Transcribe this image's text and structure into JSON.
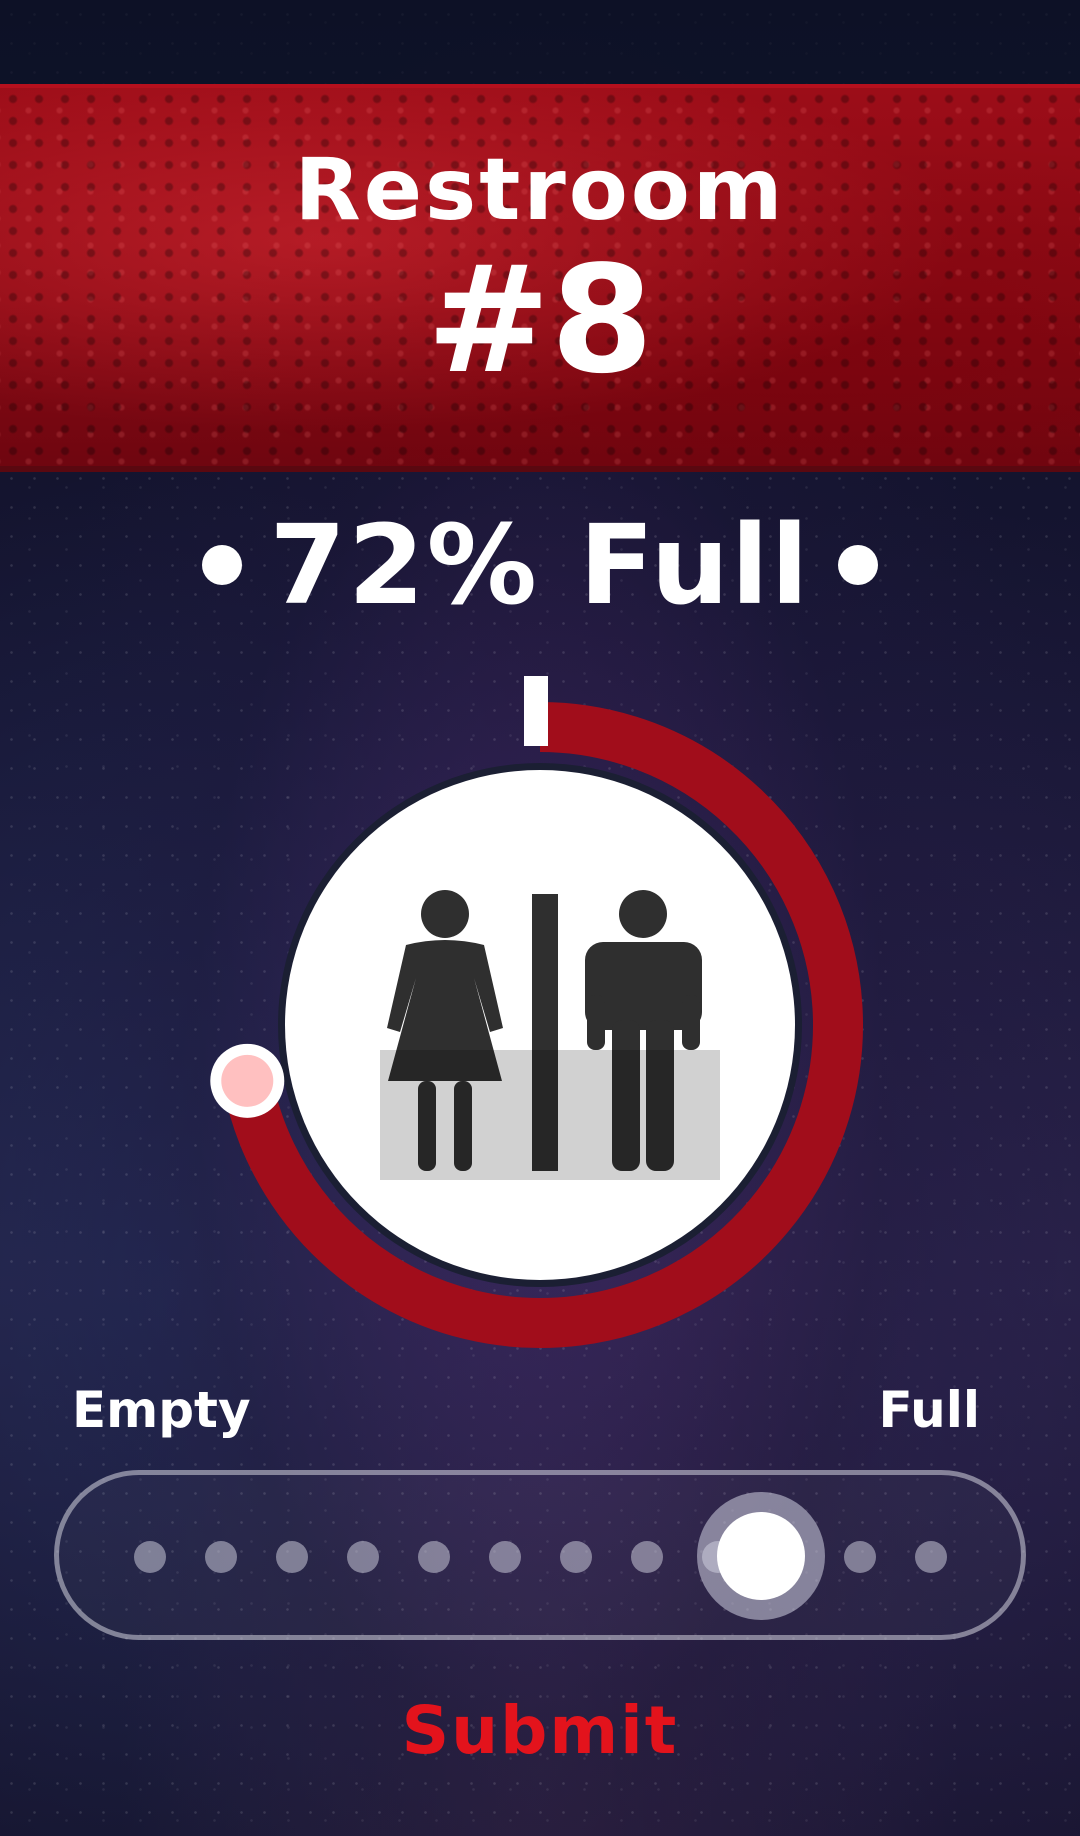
{
  "header": {
    "title": "Restroom",
    "number": "#8"
  },
  "status": {
    "text": "72% Full",
    "fill_percent": 72
  },
  "gauge": {
    "fill_fraction": 0.72,
    "ring_color": "#a10d1b",
    "knob_color": "#ffc0c0",
    "icon": "restroom-male-female-icon"
  },
  "slider": {
    "min_label": "Empty",
    "max_label": "Full",
    "steps": 12,
    "selected_step": 9
  },
  "actions": {
    "submit_label": "Submit",
    "submit_color": "#e3131c"
  }
}
